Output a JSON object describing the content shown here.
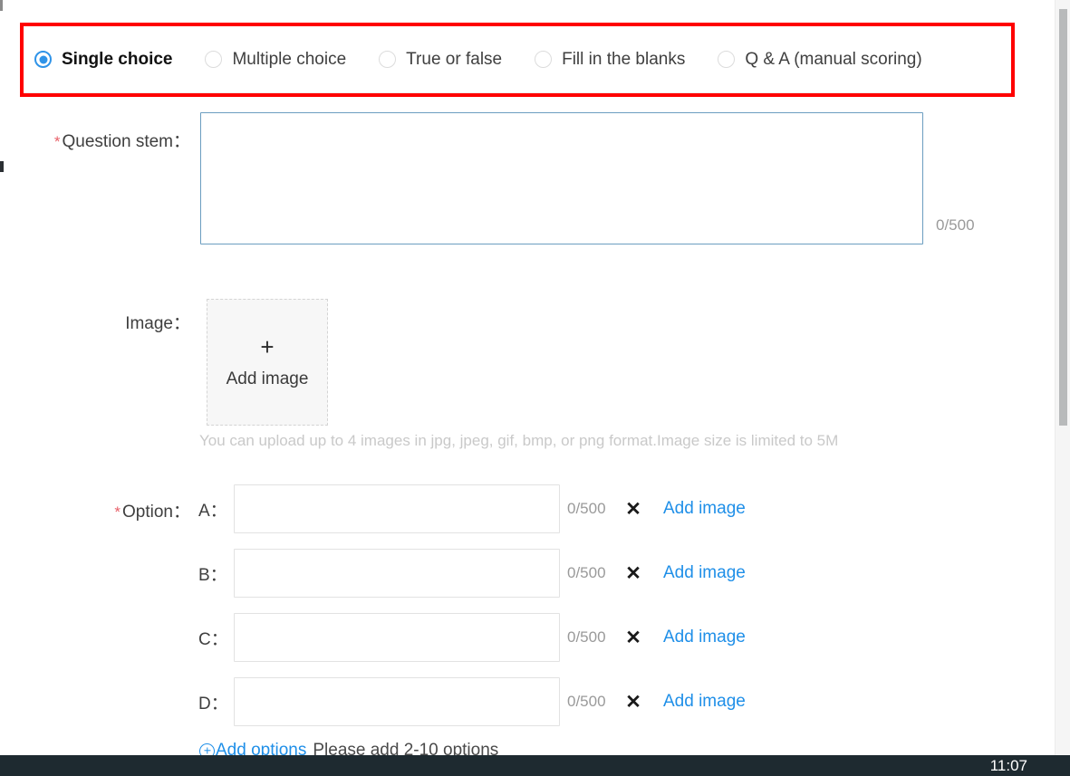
{
  "question_types": {
    "options": [
      {
        "label": "Single choice",
        "selected": true
      },
      {
        "label": "Multiple choice",
        "selected": false
      },
      {
        "label": "True or false",
        "selected": false
      },
      {
        "label": "Fill in the blanks",
        "selected": false
      },
      {
        "label": "Q & A (manual scoring)",
        "selected": false
      }
    ],
    "highlight_color": "#ff0000"
  },
  "question_stem": {
    "label": "Question stem：",
    "required_mark": "*",
    "value": "",
    "placeholder": "",
    "counter": "0/500"
  },
  "image": {
    "label": "Image：",
    "upload_plus": "+",
    "upload_text": "Add image",
    "hint": "You can upload up to 4 images in jpg, jpeg, gif, bmp, or png format.Image size is limited to 5M"
  },
  "options_section": {
    "label": "Option：",
    "required_mark": "*",
    "rows": [
      {
        "letter": "A：",
        "value": "",
        "counter": "0/500",
        "remove": "✕",
        "add_image": "Add image"
      },
      {
        "letter": "B：",
        "value": "",
        "counter": "0/500",
        "remove": "✕",
        "add_image": "Add image"
      },
      {
        "letter": "C：",
        "value": "",
        "counter": "0/500",
        "remove": "✕",
        "add_image": "Add image"
      },
      {
        "letter": "D：",
        "value": "",
        "counter": "0/500",
        "remove": "✕",
        "add_image": "Add image"
      }
    ],
    "add_options_label": "Add options",
    "add_options_hint": "Please add 2-10 options"
  },
  "taskbar": {
    "clock": "11:07"
  },
  "colors": {
    "accent_blue": "#1f8fe8",
    "radio_blue": "#2f93e8",
    "required_red": "#e8616a",
    "highlight_red": "#ff0000",
    "focus_border": "#6b9dc0"
  }
}
